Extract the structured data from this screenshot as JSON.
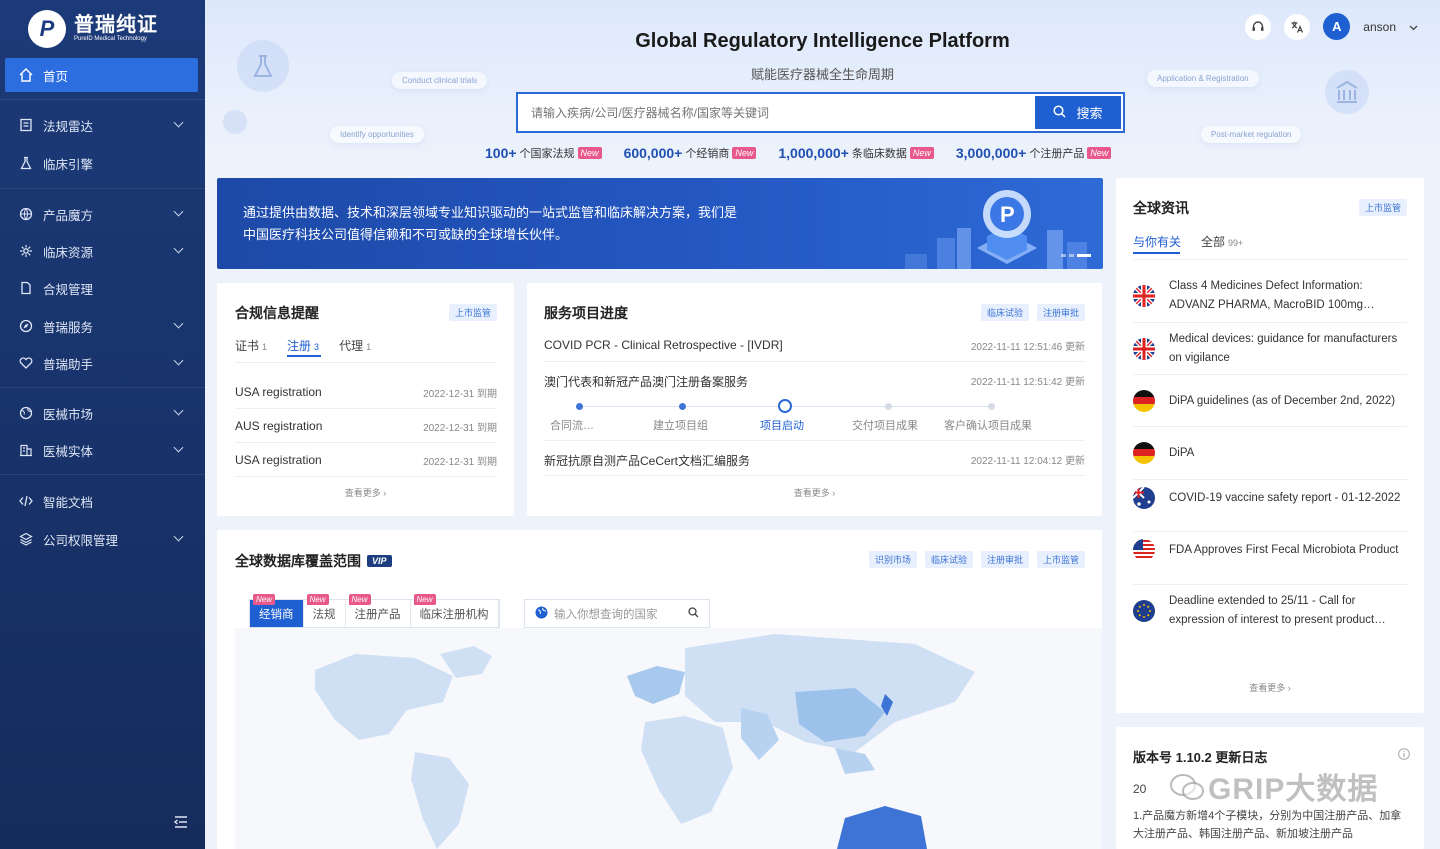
{
  "sidebar": {
    "logo_cn": "普瑞纯证",
    "logo_en": "PureID Medical Technology",
    "items": [
      {
        "label": "首页"
      },
      {
        "label": "法规雷达"
      },
      {
        "label": "临床引擎"
      },
      {
        "label": "产品魔方"
      },
      {
        "label": "临床资源"
      },
      {
        "label": "合规管理"
      },
      {
        "label": "普瑞服务"
      },
      {
        "label": "普瑞助手"
      },
      {
        "label": "医械市场"
      },
      {
        "label": "医械实体"
      },
      {
        "label": "智能文档"
      },
      {
        "label": "公司权限管理"
      }
    ]
  },
  "header": {
    "title": "Global Regulatory Intelligence Platform",
    "subtitle": "赋能医疗器械全生命周期",
    "search_placeholder": "请输入疾病/公司/医疗器械名称/国家等关键词",
    "search_button": "搜索",
    "user_initial": "A",
    "user_name": "anson",
    "float_tags": [
      "Conduct clinical trials",
      "Identify opportunities",
      "Application & Registration",
      "Post-market regulation"
    ],
    "stats": [
      {
        "num": "100+",
        "label": "个国家法规",
        "badge": "New"
      },
      {
        "num": "600,000+",
        "label": "个经销商",
        "badge": "New"
      },
      {
        "num": "1,000,000+",
        "label": "条临床数据",
        "badge": "New"
      },
      {
        "num": "3,000,000+",
        "label": "个注册产品",
        "badge": "New"
      }
    ]
  },
  "banner": {
    "line1": "通过提供由数据、技术和深层领域专业知识驱动的一站式监管和临床解决方案，我们是",
    "line2": "中国医疗科技公司值得信赖和不可或缺的全球增长伙伴。"
  },
  "compliance": {
    "title": "合规信息提醒",
    "chip": "上市监管",
    "tabs": [
      {
        "label": "证书",
        "count": "1"
      },
      {
        "label": "注册",
        "count": "3"
      },
      {
        "label": "代理",
        "count": "1"
      }
    ],
    "rows": [
      {
        "name": "USA registration",
        "date": "2022-12-31 到期"
      },
      {
        "name": "AUS registration",
        "date": "2022-12-31 到期"
      },
      {
        "name": "USA registration",
        "date": "2022-12-31 到期"
      }
    ],
    "more": "查看更多 ›"
  },
  "service": {
    "title": "服务项目进度",
    "chips": [
      "临床试验",
      "注册审批"
    ],
    "rows": [
      {
        "name": "COVID PCR - Clinical Retrospective - [IVDR]",
        "date": "2022-11-11 12:51:46 更新"
      },
      {
        "name": "澳门代表和新冠产品澳门注册备案服务",
        "date": "2022-11-11 12:51:42 更新"
      },
      {
        "name": "新冠抗原自测产品CeCert文档汇编服务",
        "date": "2022-11-11 12:04:12 更新"
      }
    ],
    "steps": [
      "合同流…",
      "建立项目组",
      "项目启动",
      "交付项目成果",
      "客户确认项目成果"
    ],
    "current_step": 3,
    "more": "查看更多 ›"
  },
  "coverage": {
    "title": "全球数据库覆盖范围",
    "vip": "VIP",
    "chips": [
      "识别市场",
      "临床试验",
      "注册审批",
      "上市监管"
    ],
    "tabs": [
      {
        "label": "经销商",
        "badge": "New"
      },
      {
        "label": "法规",
        "badge": "New"
      },
      {
        "label": "注册产品",
        "badge": "New"
      },
      {
        "label": "临床注册机构",
        "badge": "New"
      }
    ],
    "search_placeholder": "输入你想查询的国家"
  },
  "news": {
    "title": "全球资讯",
    "chip": "上市监管",
    "tabs": [
      {
        "label": "与你有关",
        "count": ""
      },
      {
        "label": "全部",
        "count": "99+"
      }
    ],
    "items": [
      {
        "flag": "uk",
        "text": "Class 4 Medicines Defect Information: ADVANZ PHARMA, MacroBID 100mg…"
      },
      {
        "flag": "uk",
        "text": "Medical devices: guidance for manufacturers on vigilance"
      },
      {
        "flag": "de",
        "text": "DiPA guidelines (as of December 2nd, 2022)"
      },
      {
        "flag": "de",
        "text": "DiPA"
      },
      {
        "flag": "au",
        "text": "COVID-19 vaccine safety report - 01-12-2022"
      },
      {
        "flag": "us",
        "text": "FDA Approves First Fecal Microbiota Product"
      },
      {
        "flag": "eu",
        "text": "Deadline extended to 25/11 - Call for expression of interest to present product…"
      }
    ],
    "more": "查看更多 ›"
  },
  "changelog": {
    "title": "版本号 1.10.2 更新日志",
    "date_prefix": "20",
    "text": "1.产品魔方新增4个子模块，分别为中国注册产品、加拿大注册产品、韩国注册产品、新加坡注册产品"
  },
  "watermark": "GRIP大数据",
  "colors": {
    "primary": "#1e5fd1",
    "sidebar": "#1c3a78",
    "badge": "#e9588a"
  }
}
